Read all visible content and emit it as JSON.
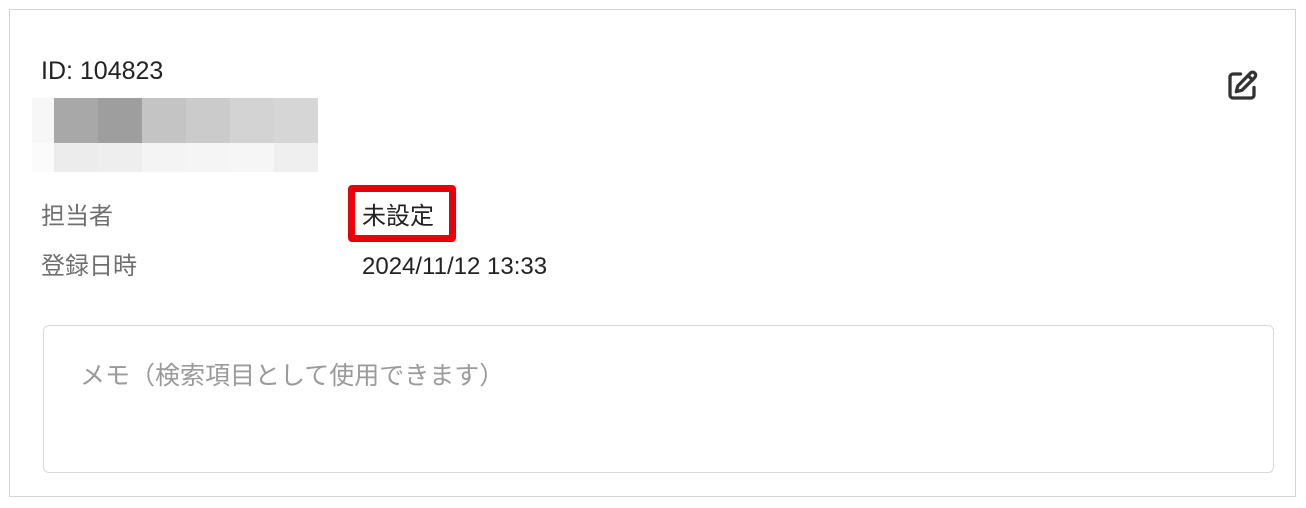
{
  "record": {
    "id_text": "ID: 104823"
  },
  "details": {
    "assignee_label": "担当者",
    "assignee_value": "未設定",
    "registered_label": "登録日時",
    "registered_value": "2024/11/12 13:33"
  },
  "memo": {
    "value": "",
    "placeholder": "メモ（検索項目として使用できます）"
  },
  "icons": {
    "edit": "edit-icon"
  },
  "colors": {
    "highlight": "#e8000b",
    "border": "#d4d4d4",
    "label_text": "#6f6f6f",
    "value_text": "#222222",
    "placeholder_text": "#9a9a9a"
  }
}
